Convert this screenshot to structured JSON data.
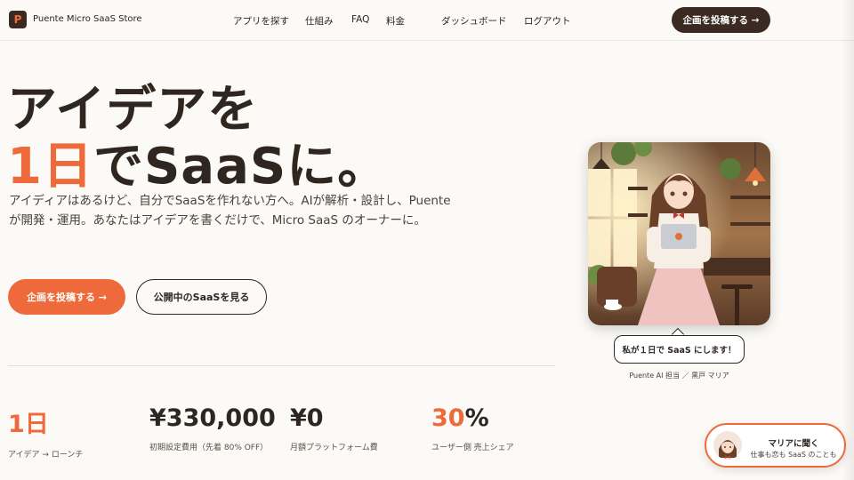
{
  "header": {
    "logo_letter": "P",
    "brand": "Puente Micro SaaS Store",
    "nav": [
      "アプリを探す",
      "仕組み",
      "FAQ",
      "料金",
      "ダッシュボード",
      "ログアウト"
    ],
    "cta": "企画を投稿する →"
  },
  "hero": {
    "line1": "アイデアを",
    "line2_accent": "1日",
    "line2_rest": "でSaaSに。",
    "description": "アイディアはあるけど、自分でSaaSを作れない方へ。AIが解析・設計し、Puenteが開発・運用。あなたはアイデアを書くだけで、Micro SaaS のオーナーに。",
    "primary_button": "企画を投稿する →",
    "secondary_button": "公開中のSaaSを見る"
  },
  "stats": [
    {
      "value_accent": "1",
      "value_accent2": "日",
      "value": "",
      "label": "アイデア → ローンチ"
    },
    {
      "value_accent": "",
      "value_accent2": "",
      "value": "¥330,000",
      "label": "初期設定費用（先着 80% OFF）"
    },
    {
      "value_accent": "",
      "value_accent2": "",
      "value": "¥0",
      "label": "月額プラットフォーム費"
    },
    {
      "value_accent": "30",
      "value_accent2": "",
      "value": "%",
      "label": "ユーザー側 売上シェア"
    }
  ],
  "mascot": {
    "bubble": "私が１日で SaaS にします！",
    "caption": "Puente AI 担当 ／ 黒戸 マリア"
  },
  "chat": {
    "title": "マリアに聞く",
    "subtitle": "仕事も恋も SaaS のことも"
  },
  "colors": {
    "accent": "#ef6a3a",
    "dark": "#3a2a22",
    "background": "#fbfaf6"
  }
}
